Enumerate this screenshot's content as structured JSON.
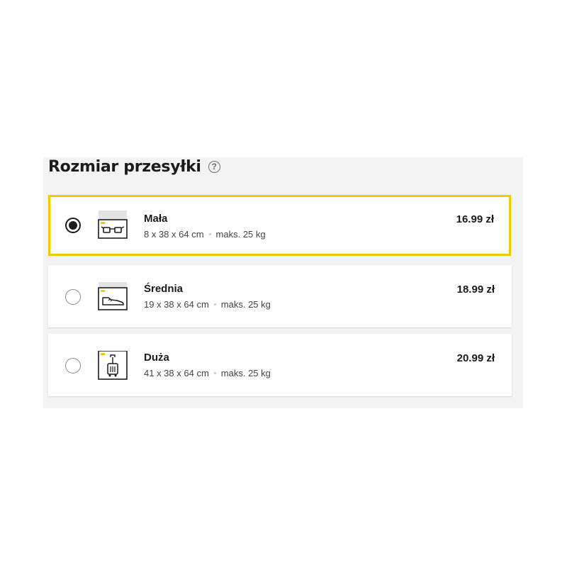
{
  "section": {
    "title": "Rozmiar przesyłki",
    "help_glyph": "?"
  },
  "colors": {
    "accent": "#f3c900",
    "panel_bg": "#f3f3f3"
  },
  "options": [
    {
      "name": "Mała",
      "dimensions": "8 x 38 x 64 cm",
      "max_weight": "maks. 25 kg",
      "price": "16.99 zł",
      "selected": true,
      "icon": "small-parcel-glasses-icon"
    },
    {
      "name": "Średnia",
      "dimensions": "19 x 38 x 64 cm",
      "max_weight": "maks. 25 kg",
      "price": "18.99 zł",
      "selected": false,
      "icon": "medium-parcel-shoe-icon"
    },
    {
      "name": "Duża",
      "dimensions": "41 x 38 x 64 cm",
      "max_weight": "maks. 25 kg",
      "price": "20.99 zł",
      "selected": false,
      "icon": "large-parcel-suitcase-icon"
    }
  ]
}
